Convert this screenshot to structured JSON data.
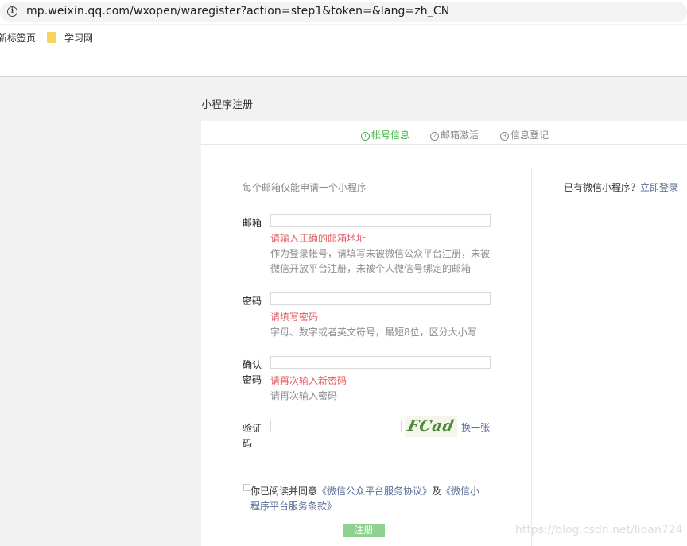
{
  "browser": {
    "url": "mp.weixin.qq.com/wxopen/waregister?action=step1&token=&lang=zh_CN",
    "bookmarks": [
      "新标签页",
      "学习网"
    ]
  },
  "page": {
    "title": "小程序注册",
    "steps": [
      {
        "num": "1",
        "label": "帐号信息"
      },
      {
        "num": "2",
        "label": "邮箱激活"
      },
      {
        "num": "3",
        "label": "信息登记"
      }
    ],
    "intro": "每个邮箱仅能申请一个小程序",
    "email": {
      "label": "邮箱",
      "error": "请输入正确的邮箱地址",
      "tip_line1": "作为登录帐号，请填写未被微信公众平台注册，未被",
      "tip_line2": "微信开放平台注册，未被个人微信号绑定的邮箱"
    },
    "password": {
      "label": "密码",
      "error": "请填写密码",
      "tip": "字母、数字或者英文符号，最短8位，区分大小写"
    },
    "confirm": {
      "label_line1": "确认",
      "label_line2": "密码",
      "error": "请再次输入新密码",
      "tip": "请再次输入密码"
    },
    "captcha": {
      "label_line1": "验证",
      "label_line2": "码",
      "image_text": "FCad",
      "refresh": "换一张"
    },
    "agreement": {
      "prefix": "你已阅读并同意",
      "link1": "《微信公众平台服务协议》",
      "and": "及",
      "link2": "《微信小程序平台服务条款》"
    },
    "register_button": "注册",
    "login_prompt": "已有微信小程序？",
    "login_link": "立即登录"
  },
  "watermark": "https://blog.csdn.net/lidan724"
}
